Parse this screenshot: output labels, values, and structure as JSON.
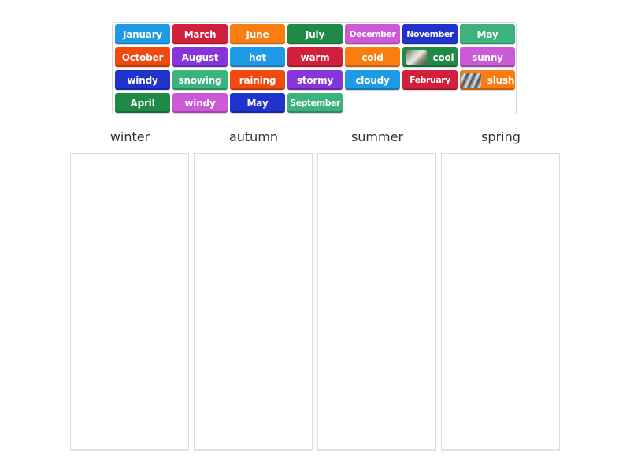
{
  "tray": {
    "tiles": [
      {
        "label": "January",
        "color": "#1e9be4",
        "row": 0,
        "col": 0
      },
      {
        "label": "March",
        "color": "#d21f3c",
        "row": 0,
        "col": 1
      },
      {
        "label": "June",
        "color": "#fb7d11",
        "row": 0,
        "col": 2
      },
      {
        "label": "July",
        "color": "#1f8a46",
        "row": 0,
        "col": 3
      },
      {
        "label": "December",
        "color": "#cc5ad7",
        "row": 0,
        "col": 4
      },
      {
        "label": "November",
        "color": "#2033cc",
        "row": 0,
        "col": 5
      },
      {
        "label": "May",
        "color": "#3cb27d",
        "row": 0,
        "col": 6
      },
      {
        "label": "October",
        "color": "#f04a0f",
        "row": 1,
        "col": 0
      },
      {
        "label": "August",
        "color": "#8635d9",
        "row": 1,
        "col": 1
      },
      {
        "label": "hot",
        "color": "#1e9be4",
        "row": 1,
        "col": 2
      },
      {
        "label": "warm",
        "color": "#d21f3c",
        "row": 1,
        "col": 3
      },
      {
        "label": "cold",
        "color": "#fb7d11",
        "row": 1,
        "col": 4
      },
      {
        "label": "cool",
        "color": "#1f8a46",
        "row": 1,
        "col": 5,
        "image": "cool"
      },
      {
        "label": "sunny",
        "color": "#cc5ad7",
        "row": 1,
        "col": 6
      },
      {
        "label": "windy",
        "color": "#2033cc",
        "row": 2,
        "col": 0
      },
      {
        "label": "snowing",
        "color": "#3cb27d",
        "row": 2,
        "col": 1
      },
      {
        "label": "raining",
        "color": "#f04a0f",
        "row": 2,
        "col": 2
      },
      {
        "label": "stormy",
        "color": "#8635d9",
        "row": 2,
        "col": 3
      },
      {
        "label": "cloudy",
        "color": "#1e9be4",
        "row": 2,
        "col": 4
      },
      {
        "label": "February",
        "color": "#d21f3c",
        "row": 2,
        "col": 5
      },
      {
        "label": "slush",
        "color": "#fb7d11",
        "row": 2,
        "col": 6,
        "image": "slush"
      },
      {
        "label": "April",
        "color": "#1f8a46",
        "row": 3,
        "col": 0
      },
      {
        "label": "windy",
        "color": "#cc5ad7",
        "row": 3,
        "col": 1
      },
      {
        "label": "May",
        "color": "#2033cc",
        "row": 3,
        "col": 2
      },
      {
        "label": "September",
        "color": "#3cb27d",
        "row": 3,
        "col": 3
      }
    ]
  },
  "groups": [
    {
      "title": "winter"
    },
    {
      "title": "autumn"
    },
    {
      "title": "summer"
    },
    {
      "title": "spring"
    }
  ]
}
